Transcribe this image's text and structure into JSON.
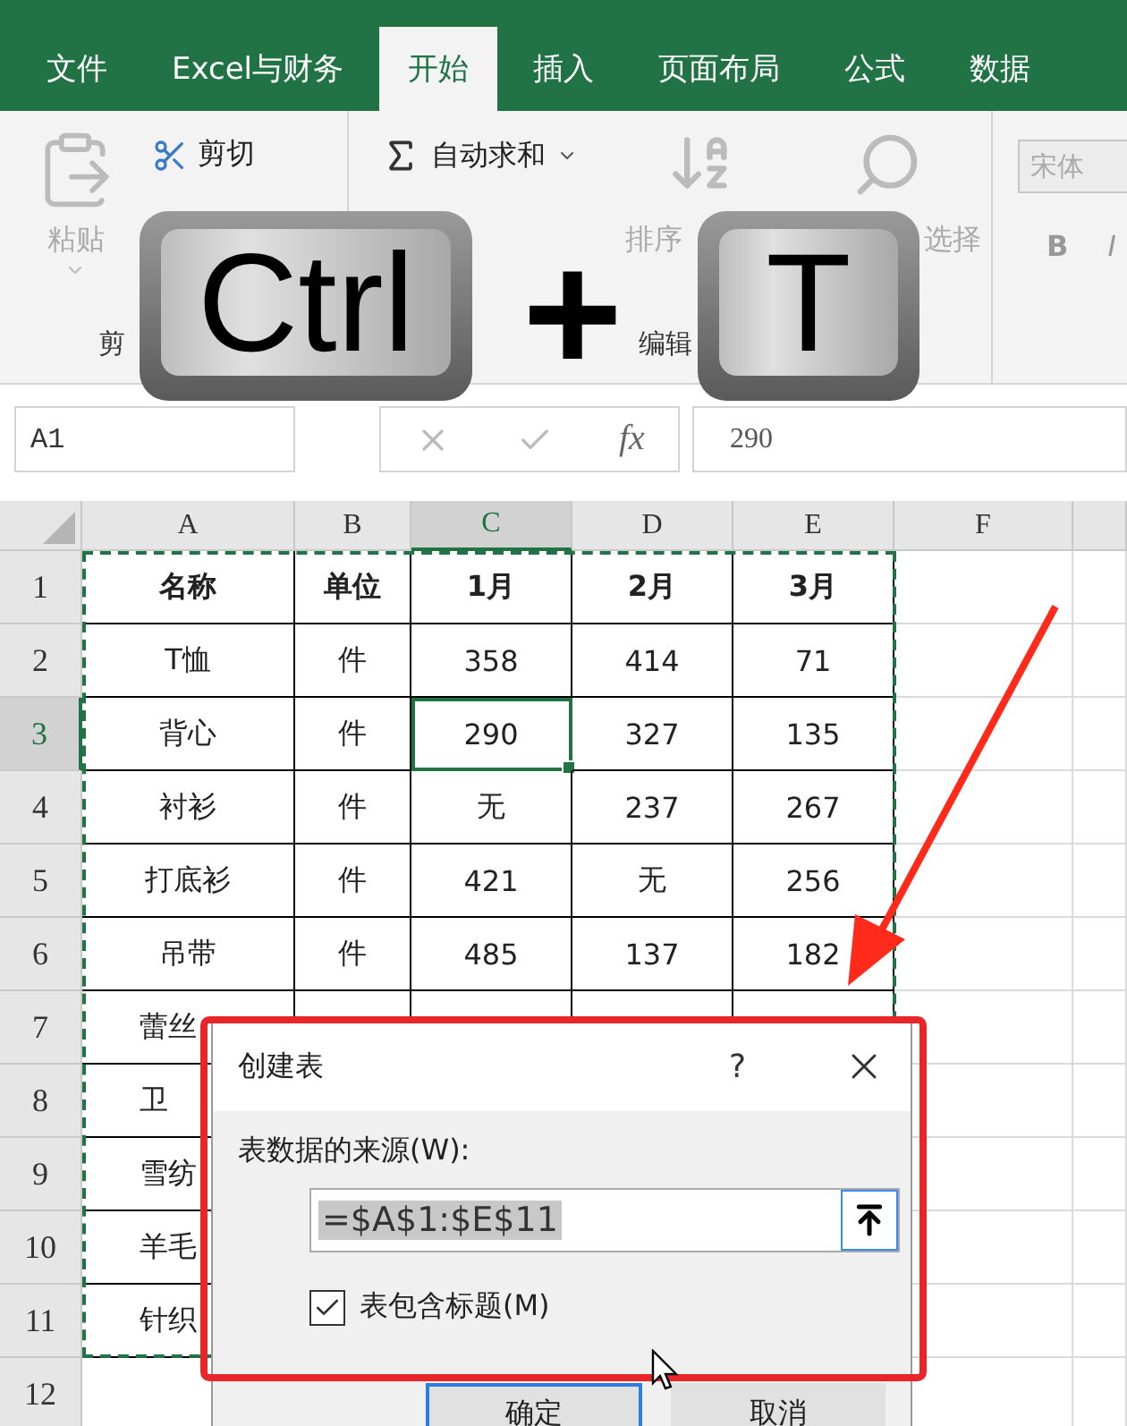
{
  "ribbon_tabs": [
    {
      "label": "文件",
      "selected": false
    },
    {
      "label": "Excel与财务",
      "selected": false
    },
    {
      "label": "开始",
      "selected": true
    },
    {
      "label": "插入",
      "selected": false
    },
    {
      "label": "页面布局",
      "selected": false
    },
    {
      "label": "公式",
      "selected": false
    },
    {
      "label": "数据",
      "selected": false
    }
  ],
  "ribbon": {
    "clipboard": {
      "paste": "粘贴",
      "cut": "剪切",
      "group_label": "剪"
    },
    "editing": {
      "autosum": "自动求和",
      "sort": "排序",
      "find": "选择",
      "group_label": "编辑"
    },
    "font": {
      "font_name": "宋体",
      "bold": "B",
      "italic": "I"
    }
  },
  "formula_bar": {
    "name_box": "A1",
    "fx": "fx",
    "value": "290"
  },
  "columns": [
    {
      "label": "A",
      "selected": false
    },
    {
      "label": "B",
      "selected": false
    },
    {
      "label": "C",
      "selected": true
    },
    {
      "label": "D",
      "selected": false
    },
    {
      "label": "E",
      "selected": false
    },
    {
      "label": "F",
      "selected": false
    }
  ],
  "rows": [
    {
      "header": "1",
      "selected": false,
      "cells": [
        {
          "text": "名称",
          "selected": false
        },
        {
          "text": "单位",
          "selected": false
        },
        {
          "text": "1月",
          "selected": false
        },
        {
          "text": "2月",
          "selected": false
        },
        {
          "text": "3月",
          "selected": false
        }
      ]
    },
    {
      "header": "2",
      "selected": false,
      "cells": [
        {
          "text": "T恤",
          "selected": false
        },
        {
          "text": "件",
          "selected": false
        },
        {
          "text": "358",
          "selected": false
        },
        {
          "text": "414",
          "selected": false
        },
        {
          "text": "71",
          "selected": false
        }
      ]
    },
    {
      "header": "3",
      "selected": true,
      "cells": [
        {
          "text": "背心",
          "selected": false
        },
        {
          "text": "件",
          "selected": false
        },
        {
          "text": "290",
          "selected": true
        },
        {
          "text": "327",
          "selected": false
        },
        {
          "text": "135",
          "selected": false
        }
      ]
    },
    {
      "header": "4",
      "selected": false,
      "cells": [
        {
          "text": "衬衫",
          "selected": false
        },
        {
          "text": "件",
          "selected": false
        },
        {
          "text": "无",
          "selected": false
        },
        {
          "text": "237",
          "selected": false
        },
        {
          "text": "267",
          "selected": false
        }
      ]
    },
    {
      "header": "5",
      "selected": false,
      "cells": [
        {
          "text": "打底衫",
          "selected": false
        },
        {
          "text": "件",
          "selected": false
        },
        {
          "text": "421",
          "selected": false
        },
        {
          "text": "无",
          "selected": false
        },
        {
          "text": "256",
          "selected": false
        }
      ]
    },
    {
      "header": "6",
      "selected": false,
      "cells": [
        {
          "text": "吊带",
          "selected": false
        },
        {
          "text": "件",
          "selected": false
        },
        {
          "text": "485",
          "selected": false
        },
        {
          "text": "137",
          "selected": false
        },
        {
          "text": "182",
          "selected": false
        }
      ]
    },
    {
      "header": "7",
      "selected": false,
      "cells": [
        {
          "text": "蕾丝",
          "selected": false
        }
      ]
    },
    {
      "header": "8",
      "selected": false,
      "cells": [
        {
          "text": "卫",
          "selected": false
        }
      ]
    },
    {
      "header": "9",
      "selected": false,
      "cells": [
        {
          "text": "雪纺",
          "selected": false
        }
      ]
    },
    {
      "header": "10",
      "selected": false,
      "cells": [
        {
          "text": "羊毛",
          "selected": false
        }
      ]
    },
    {
      "header": "11",
      "selected": false,
      "cells": [
        {
          "text": "针织",
          "selected": false
        }
      ]
    },
    {
      "header": "12",
      "selected": false,
      "cells": []
    }
  ],
  "key_overlay": {
    "keys": [
      "Ctrl",
      "T"
    ],
    "plus": "+"
  },
  "dialog": {
    "title": "创建表",
    "help": "?",
    "source_label": "表数据的来源(W):",
    "source_value": "=$A$1:$E$11",
    "has_headers": {
      "label": "表包含标题(M)",
      "checked": true
    },
    "buttons": [
      {
        "label": "确定",
        "default": true
      },
      {
        "label": "取消",
        "default": false
      }
    ]
  }
}
